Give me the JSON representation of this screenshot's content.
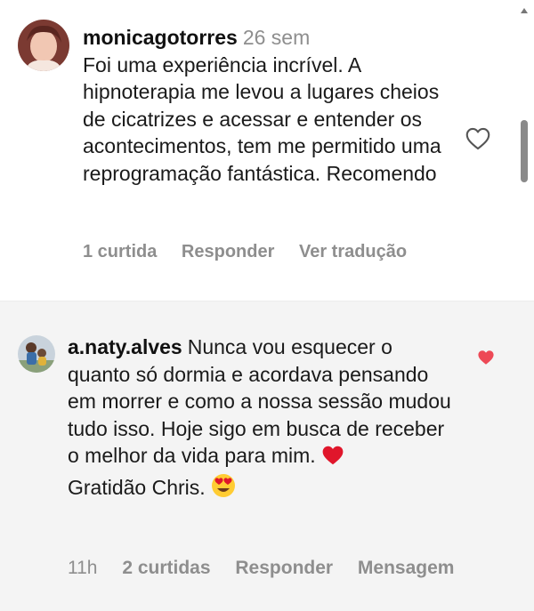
{
  "comments": [
    {
      "username": "monicagotorres",
      "time": "26 sem",
      "text": "Foi uma experiência incrível. A hipnoterapia me levou a lugares cheios de cicatrizes e acessar e entender os acontecimentos, tem me permitido uma reprogramação fantástica. Recomendo",
      "likes": "1 curtida",
      "reply": "Responder",
      "translate": "Ver tradução",
      "liked": false
    },
    {
      "username": "a.naty.alves",
      "text_part1": "Nunca vou esquecer o quanto só dormia e acordava pensando em morrer e como a nossa sessão mudou tudo isso. Hoje sigo em busca de receber o melhor da vida para mim.",
      "text_part2": "Gratidão Chris.",
      "emoji_heart": "❤️",
      "emoji_love": "😍",
      "time": "11h",
      "likes": "2 curtidas",
      "reply": "Responder",
      "message": "Mensagem",
      "liked": true
    }
  ],
  "colors": {
    "like_active": "#ed4956",
    "meta_text": "#8e8e8e",
    "second_bg": "#f4f4f4"
  },
  "icons": {
    "like_empty": "heart-outline-icon",
    "like_filled": "heart-filled-icon"
  }
}
